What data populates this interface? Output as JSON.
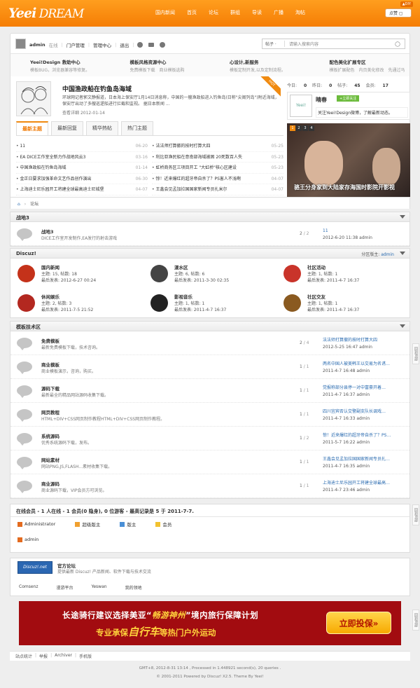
{
  "brand": {
    "logo_a": "Yee",
    "logo_b": "i",
    "logo_c": " DREAM",
    "diy": "▲DIY",
    "like": "点赞 ▢"
  },
  "topnav": [
    "国内新闻",
    "首页",
    "论坛",
    "群组",
    "导读",
    "广播",
    "淘帖"
  ],
  "userbar": {
    "user": "admin",
    "status": "在线",
    "links": [
      "门户管理",
      "管理中心",
      "退出"
    ],
    "search_scope": "帖子 ·",
    "search_placeholder": "请输入搜索内容"
  },
  "quick": [
    {
      "title": "Yeei!Design 救助中心",
      "sub": "模板BUG，浏览器兼容等修复。"
    },
    {
      "title": "模板风格资源中心",
      "sub": "免费模板下载　商业模板选购"
    },
    {
      "title": "心设计,新服务",
      "sub": "模板定制开发,以及定制流程。"
    },
    {
      "title": "配色美化扩展专区",
      "sub": "模板扩展配色　内页美化修改　先通过马"
    }
  ],
  "headline": {
    "title": "中国渔政船在钓鱼岛海域",
    "body": "环球网记者郭文静报道，日本海上保安厅1月14日消息称，中国的一艘渔政船进入钓鱼岛(日称\"尖阁列岛\")附近海域，保安厅出动了多艘巡逻船进行拦截和监视。 据日本新闻 ...",
    "more": "查看详细",
    "date": "2012-01-14",
    "hot": "HOT"
  },
  "tabs": [
    "最新主题",
    "最新回复",
    "精华热帖",
    "热门主题"
  ],
  "list_left": [
    {
      "t": "11",
      "d": "06-20"
    },
    {
      "t": "EA DICE工作室全新力作战地风云3",
      "d": "03-16"
    },
    {
      "t": "中国渔政船在钓鱼岛海域",
      "d": "01-14"
    },
    {
      "t": "金正日要求加强革命文艺作品创作演出",
      "d": "06-30"
    },
    {
      "t": "上海迪士尼乐园开工将建全球最高迪士尼城堡",
      "d": "04-07"
    }
  ],
  "list_right": [
    {
      "t": "法法师打算撤的按时打算大四",
      "d": "05-25"
    },
    {
      "t": "利比亚渔民船在意南部海域被困 20死数百人失",
      "d": "05-23"
    },
    {
      "t": "虹桥商务区三项目开工 \"大虹桥\"核心区建设",
      "d": "05-23"
    },
    {
      "t": "惊！近来爆红的超牙帝自杀了？PS害人不浅啊",
      "d": "04-07"
    },
    {
      "t": "王鑫会见孟加拉国国家新闻专员扎米尔",
      "d": "04-07"
    }
  ],
  "stats": {
    "today_label": "今日:",
    "today": "0",
    "yesterday_label": "昨日:",
    "yesterday": "0",
    "posts_label": "帖子:",
    "posts": "45",
    "members_label": "会员:",
    "members": "17"
  },
  "sina": {
    "name": "晴春",
    "follow": "+立即关注",
    "text": "关注Yeei!Design微博，了解最新动态。",
    "badge": "Yeei!"
  },
  "photo": {
    "pages": [
      "1",
      "2",
      "3",
      "4"
    ],
    "caption": "骆王分身家到大陆家存海国时影院开影视"
  },
  "crumb": {
    "home": "⌂",
    "sep": "›",
    "here": "论坛"
  },
  "forums": {
    "zd": {
      "title": "战地3",
      "rows": [
        {
          "name": "战地3",
          "desc": "DICE工作室开发制作,EA发行的射击游戏",
          "cnt_a": "2",
          "cnt_b": "2",
          "last_t": "11",
          "last_m": "2012-6-20 11:38 admin"
        }
      ]
    },
    "dz": {
      "title": "Discuz!",
      "mod_label": "分区版主:",
      "mod": "admin",
      "cells": [
        {
          "name": "国内新闻",
          "l1": "主题: 15, 帖数: 18",
          "l2": "最后发表: 2012-6-27 00:24",
          "c": "#c4321a"
        },
        {
          "name": "漾水区",
          "l1": "主题: 6, 帖数: 6",
          "l2": "最后发表: 2011-3-30 02:35",
          "c": "#444"
        },
        {
          "name": "社区活动",
          "l1": "主题: 1, 帖数: 1",
          "l2": "最后发表: 2011-4-7 16:37",
          "c": "#c9342a"
        },
        {
          "name": "休闲娱乐",
          "l1": "主题: 2, 帖数: 3",
          "l2": "最后发表: 2011-7-5 21:52",
          "c": "#b32820"
        },
        {
          "name": "影视音乐",
          "l1": "主题: 1, 帖数: 1",
          "l2": "最后发表: 2011-4-7 16:37",
          "c": "#222"
        },
        {
          "name": "社区交友",
          "l1": "主题: 1, 帖数: 1",
          "l2": "最后发表: 2011-4-7 16:37",
          "c": "#8a5a20"
        }
      ]
    },
    "mb": {
      "title": "模板技术区",
      "rows": [
        {
          "name": "免费模板",
          "desc": "最新免费模板下载，技术咨询。",
          "cnt_a": "2",
          "cnt_b": "4",
          "last_t": "法法师打算撤的按时打算大四",
          "last_m": "2012-5-25 16:47 admin"
        },
        {
          "name": "商业模板",
          "desc": "商业模板演示，咨询，购买。",
          "cnt_a": "1",
          "cnt_b": "1",
          "last_t": "两名中国人被美韩王以交易为名诱…",
          "last_m": "2011-4-7 16:48 admin"
        },
        {
          "name": "源码下载",
          "desc": "最新最全的精品网站源码收集下载。",
          "cnt_a": "1",
          "cnt_b": "1",
          "last_t": "党报称部分县停一对中富豪开着…",
          "last_m": "2011-4-7 16:37 admin"
        },
        {
          "name": "网页教程",
          "desc": "HTML+DIV+CSS网页制作教程HTML+DIV+CSS网页制作教程。",
          "cnt_a": "1",
          "cnt_b": "1",
          "last_t": "四川宜宾否认交警副支队长调戏…",
          "last_m": "2011-4-7 16:33 admin"
        },
        {
          "name": "系统源码",
          "desc": "优秀系统源码下载，发布。",
          "cnt_a": "1",
          "cnt_b": "2",
          "last_t": "惊！近来爆红的超牙帝自杀了？PS…",
          "last_m": "2011-5-7 16:22 admin"
        },
        {
          "name": "网站素材",
          "desc": "网站PNG,JS,FLASH...素材收集下载。",
          "cnt_a": "1",
          "cnt_b": "1",
          "last_t": "王鑫会见孟加拉国国家新闻专员扎…",
          "last_m": "2011-4-7 16:35 admin"
        },
        {
          "name": "商业源码",
          "desc": "商业源码下载，VIP会员方可浏览。",
          "cnt_a": "1",
          "cnt_b": "1",
          "last_t": "上海迪士尼乐园开工将建全球最高…",
          "last_m": "2011-4-7 23:46 admin"
        }
      ]
    }
  },
  "online": {
    "title": "在线会员 - 1 人在线 - 1 会员(0 隐身), 0 位游客 - 最高记录是 5 于 2011-7-7.",
    "legend": [
      {
        "label": "Administrator",
        "c": "#e36b1f"
      },
      {
        "label": "超级版主",
        "c": "#f0a030"
      },
      {
        "label": "版主",
        "c": "#4a8fd6"
      },
      {
        "label": "会员",
        "c": "#f2c230"
      }
    ],
    "user": "admin"
  },
  "links": {
    "logo": "Discuz!.net",
    "name": "官方论坛",
    "desc": "提供最新 Discuz! 产品新闻、软件下载与技术交流",
    "items": [
      "Comsenz",
      "漫游平台",
      "Yeswan",
      "我的领地"
    ]
  },
  "ad": {
    "l1a": "长途骑行建议选择美亚“",
    "l1b": "畅游神州",
    "l1c": "”境内旅行保障计划",
    "l2a": "专业承保",
    "l2b": "自行车",
    "l2c": "等热门户外运动",
    "btn": "立即投保»"
  },
  "botnav": [
    "站点统计",
    "|",
    "举报",
    "|",
    "Archiver",
    "|",
    "手机版"
  ],
  "footer": {
    "l1": "GMT+8, 2012-8-31 13:14 , Processed in 1.448921 second(s), 20 queries .",
    "l2": "© 2001-2011 Powered by Discuz! X2.5. Theme By Yeei!"
  },
  "side": [
    "回到顶部",
    "回到顶部",
    "回到顶部"
  ]
}
